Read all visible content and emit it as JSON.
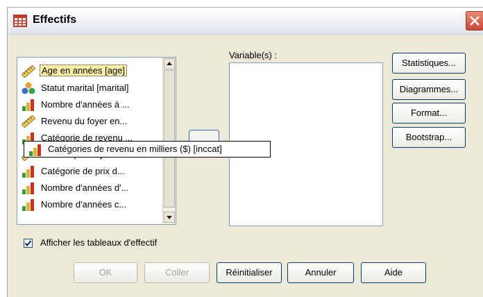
{
  "window": {
    "title": "Effectifs",
    "close_icon": "close-x-icon"
  },
  "source_list": {
    "items": [
      {
        "label": "Age en années [age]",
        "icon": "ruler-scale-icon",
        "selected": true
      },
      {
        "label": "Statut marital [marital]",
        "icon": "nominal-circles-icon"
      },
      {
        "label": "Nombre d'années à ...",
        "icon": "ordinal-bars-icon"
      },
      {
        "label": "Revenu du foyer en...",
        "icon": "ruler-scale-icon"
      },
      {
        "label": "Catégorie de revenu ...",
        "icon": "ordinal-bars-icon"
      },
      {
        "label": "Price of primary ve...",
        "icon": "ruler-scale-icon"
      },
      {
        "label": "Catégorie de prix d...",
        "icon": "ordinal-bars-icon"
      },
      {
        "label": "Nombre d'années d'...",
        "icon": "ordinal-bars-icon"
      },
      {
        "label": "Nombre d'années c...",
        "icon": "ordinal-bars-icon"
      }
    ]
  },
  "tooltip": {
    "text": "Catégories de revenu en milliers ($) [inccat]",
    "icon": "ordinal-bars-icon"
  },
  "move_button": {
    "icon": "arrow-right-icon"
  },
  "target": {
    "label": "Variable(s) :"
  },
  "side_buttons": {
    "statistics": "Statistiques...",
    "charts": "Diagrammes...",
    "format": "Format...",
    "bootstrap": "Bootstrap..."
  },
  "checkbox": {
    "label": "Afficher les tableaux d'effectif",
    "checked": true
  },
  "bottom_buttons": {
    "ok": "OK",
    "paste": "Coller",
    "reset": "Réinitialiser",
    "cancel": "Annuler",
    "help": "Aide"
  },
  "colors": {
    "dialog_bg": "#ece9d8",
    "selection": "#fff2a8",
    "button_border": "#003c74"
  }
}
